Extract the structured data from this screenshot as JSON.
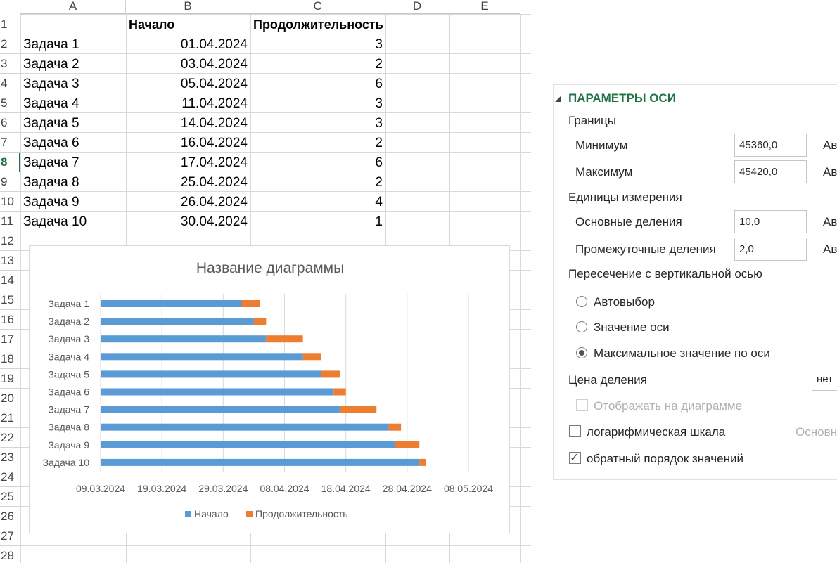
{
  "sheet": {
    "columns": [
      "A",
      "B",
      "C",
      "D",
      "E"
    ],
    "rows": [
      "1",
      "2",
      "3",
      "4",
      "5",
      "6",
      "7",
      "8",
      "9",
      "10",
      "11",
      "12",
      "13",
      "14",
      "15",
      "16",
      "17",
      "18",
      "19",
      "20",
      "21",
      "22",
      "23",
      "24",
      "25",
      "26",
      "27",
      "28"
    ],
    "active_row": "8",
    "header": {
      "a": "",
      "b": "Начало",
      "c": "Продолжительность"
    },
    "data": [
      {
        "a": "Задача 1",
        "b": "01.04.2024",
        "c": "3"
      },
      {
        "a": "Задача 2",
        "b": "03.04.2024",
        "c": "2"
      },
      {
        "a": "Задача 3",
        "b": "05.04.2024",
        "c": "6"
      },
      {
        "a": "Задача 4",
        "b": "11.04.2024",
        "c": "3"
      },
      {
        "a": "Задача 5",
        "b": "14.04.2024",
        "c": "3"
      },
      {
        "a": "Задача 6",
        "b": "16.04.2024",
        "c": "2"
      },
      {
        "a": "Задача 7",
        "b": "17.04.2024",
        "c": "6"
      },
      {
        "a": "Задача 8",
        "b": "25.04.2024",
        "c": "2"
      },
      {
        "a": "Задача 9",
        "b": "26.04.2024",
        "c": "4"
      },
      {
        "a": "Задача 10",
        "b": "30.04.2024",
        "c": "1"
      }
    ]
  },
  "chart_data": {
    "type": "bar",
    "orientation": "horizontal",
    "stacked": true,
    "title": "Название диаграммы",
    "categories": [
      "Задача 1",
      "Задача 2",
      "Задача 3",
      "Задача 4",
      "Задача 5",
      "Задача 6",
      "Задача 7",
      "Задача 8",
      "Задача 9",
      "Задача 10"
    ],
    "series": [
      {
        "name": "Начало",
        "color": "#5b9bd5",
        "values": [
          "01.04.2024",
          "03.04.2024",
          "05.04.2024",
          "11.04.2024",
          "14.04.2024",
          "16.04.2024",
          "17.04.2024",
          "25.04.2024",
          "26.04.2024",
          "30.04.2024"
        ]
      },
      {
        "name": "Продолжительность",
        "color": "#ed7d31",
        "values": [
          3,
          2,
          6,
          3,
          3,
          2,
          6,
          2,
          4,
          1
        ]
      }
    ],
    "x_tick_labels": [
      "09.03.2024",
      "19.03.2024",
      "29.03.2024",
      "08.04.2024",
      "18.04.2024",
      "28.04.2024",
      "08.05.2024"
    ],
    "xlim": [
      "09.03.2024",
      "08.05.2024"
    ],
    "x_major_unit_days": 10,
    "y_reversed": true,
    "grid": true,
    "legend": "bottom"
  },
  "pane": {
    "section_title": "ПАРАМЕТРЫ ОСИ",
    "bounds_label": "Границы",
    "min_label": "Минимум",
    "min_value": "45360,0",
    "max_label": "Максимум",
    "max_value": "45420,0",
    "auto_label": "Ав",
    "units_label": "Единицы измерения",
    "major_label": "Основные деления",
    "major_value": "10,0",
    "minor_label": "Промежуточные деления",
    "minor_value": "2,0",
    "cross_label": "Пересечение с вертикальной осью",
    "radio_auto": "Автовыбор",
    "radio_value": "Значение оси",
    "radio_max": "Максимальное значение по оси",
    "units_display_label": "Цена деления",
    "units_display_value": "нет",
    "show_on_chart": "Отображать на диаграмме",
    "log_scale": "логарифмическая шкала",
    "log_base": "Основн",
    "reverse_order": "обратный порядок значений"
  }
}
